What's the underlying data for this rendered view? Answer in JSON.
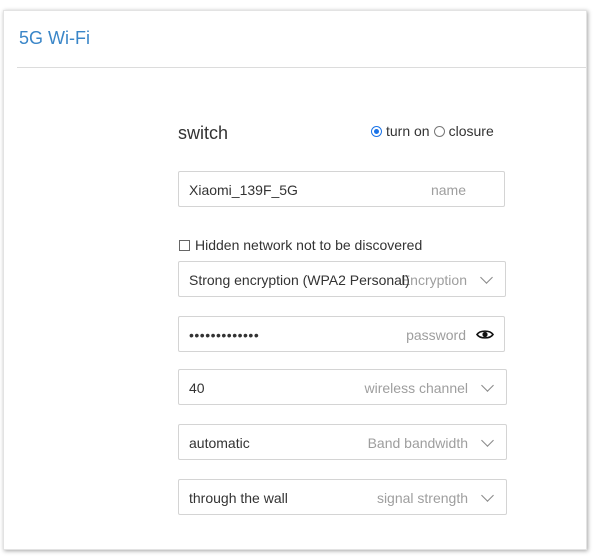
{
  "panel": {
    "title": "5G Wi-Fi"
  },
  "switch": {
    "label": "switch",
    "options": [
      {
        "label": "turn on",
        "selected": true
      },
      {
        "label": "closure",
        "selected": false
      }
    ]
  },
  "name_field": {
    "value": "Xiaomi_139F_5G",
    "hint": "name"
  },
  "hidden_network": {
    "label": "Hidden network not to be discovered",
    "checked": false
  },
  "encryption": {
    "value": "Strong encryption (WPA2 Personal)",
    "hint": "Encryption"
  },
  "password": {
    "value": "•••••••••••••",
    "hint": "password",
    "icon": "eye-icon"
  },
  "channel": {
    "value": "40",
    "hint": "wireless channel"
  },
  "bandwidth": {
    "value": "automatic",
    "hint": "Band bandwidth"
  },
  "signal": {
    "value": "through the wall",
    "hint": "signal strength"
  },
  "colors": {
    "accent": "#3a86c8",
    "radio_selected": "#1a73e8",
    "border": "#d4d4d4",
    "hint": "#9e9e9e"
  }
}
